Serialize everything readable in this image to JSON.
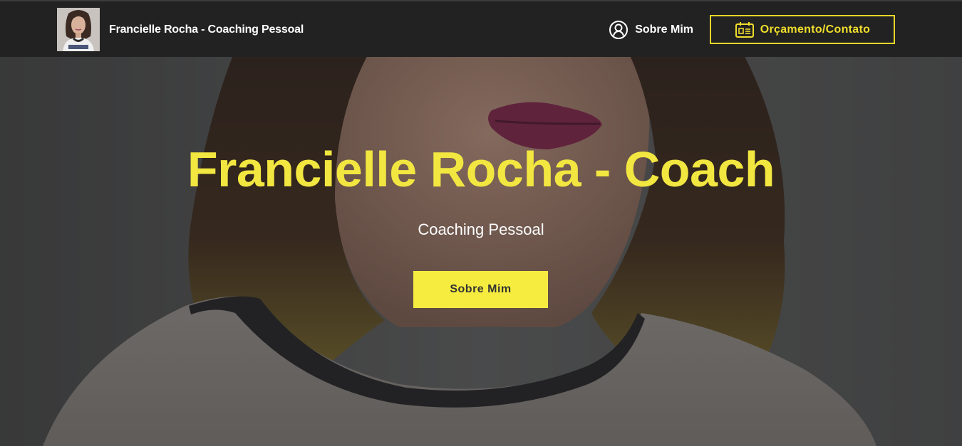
{
  "navbar": {
    "brand_title": "Francielle Rocha - Coaching Pessoal",
    "about_label": "Sobre Mim",
    "about_icon": "user-circle-icon",
    "contact_label": "Orçamento/Contato",
    "contact_icon": "id-card-icon"
  },
  "hero": {
    "title": "Francielle Rocha - Coach",
    "subtitle": "Coaching Pessoal",
    "cta_label": "Sobre Mim"
  },
  "colors": {
    "navbar_bg": "#222222",
    "accent_yellow": "#f5ec3f",
    "title_yellow": "#f2e640",
    "text_white": "#ffffff"
  }
}
